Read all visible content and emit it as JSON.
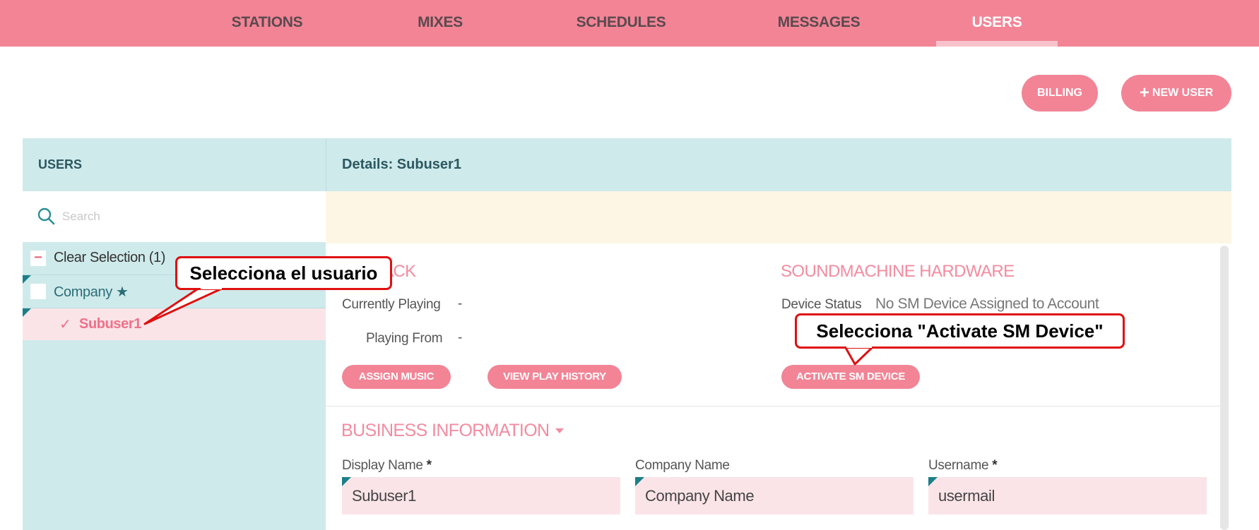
{
  "nav": {
    "tabs": [
      {
        "label": "STATIONS"
      },
      {
        "label": "MIXES"
      },
      {
        "label": "SCHEDULES"
      },
      {
        "label": "MESSAGES"
      },
      {
        "label": "USERS",
        "active": true
      }
    ]
  },
  "actions": {
    "billing": "BILLING",
    "new_user": "NEW USER",
    "new_user_icon": "plus-icon"
  },
  "users_panel": {
    "title": "USERS",
    "search_placeholder": "Search",
    "clear_selection": "Clear Selection (1)",
    "tree": [
      {
        "label": "Company ★",
        "selected": false
      },
      {
        "label": "Subuser1",
        "selected": true
      }
    ]
  },
  "details": {
    "title": "Details: Subuser1",
    "playback": {
      "title": "ACK",
      "currently_playing_label": "Currently Playing",
      "currently_playing_value": "-",
      "playing_from_label": "Playing From",
      "playing_from_value": "-",
      "assign_music": "ASSIGN MUSIC",
      "view_play_history": "VIEW PLAY HISTORY"
    },
    "hardware": {
      "title": "SOUNDMACHINE HARDWARE",
      "device_status_label": "Device Status",
      "device_status_value": "No SM Device Assigned to Account",
      "activate": "ACTIVATE SM DEVICE"
    },
    "business": {
      "title": "BUSINESS INFORMATION",
      "fields": [
        {
          "label": "Display Name",
          "required": "*",
          "value": "Subuser1"
        },
        {
          "label": "Company Name",
          "required": "",
          "value": "Company Name"
        },
        {
          "label": "Username",
          "required": "*",
          "value": "usermail"
        }
      ]
    }
  },
  "callouts": {
    "select_user": "Selecciona el usuario",
    "select_activate": "Selecciona \"Activate SM Device\"",
    "border_color": "#e01010"
  },
  "colors": {
    "brand_pink": "#f28496",
    "panel_teal": "#cfeaeb",
    "banner_cream": "#fdf6e4",
    "dark_teal": "#2c5861"
  }
}
